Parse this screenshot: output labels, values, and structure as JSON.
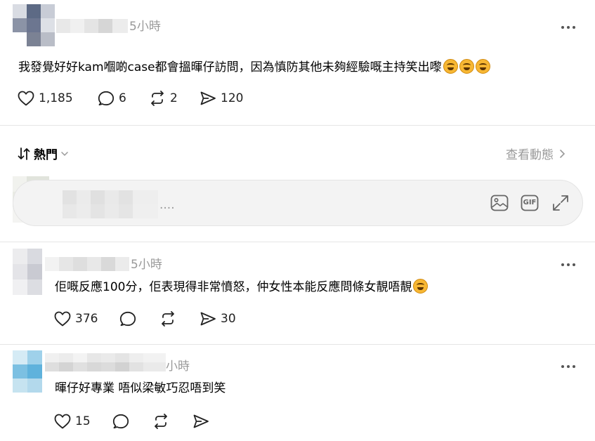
{
  "post": {
    "time": "5小時",
    "text": "我發覺好好kam嗰啲case都會搵暉仔訪問，因為慎防其他未夠經驗嘅主持笑出嚟",
    "emoji_count": 3,
    "likes": "1,185",
    "replies": "6",
    "reposts": "2",
    "shares": "120"
  },
  "filter_bar": {
    "sort_label": "熱門",
    "activity_link": "查看動態"
  },
  "composer": {
    "placeholder": "....",
    "gif_label": "GIF"
  },
  "comments": [
    {
      "time": "5小時",
      "text": "佢嘅反應100分，佢表現得非常憤怒，仲女性本能反應問條女靚唔靚",
      "emoji_count": 1,
      "likes": "376",
      "shares": "30"
    },
    {
      "time": "小時",
      "text": "暉仔好專業 唔似梁敏巧忍唔到笑",
      "emoji_count": 0,
      "likes": "15"
    }
  ],
  "colors": {
    "muted": "#999999",
    "divider": "#e5e5e5",
    "composer_bg": "#f3f3f3",
    "emoji": "#f7b733"
  },
  "icons": [
    "heart-icon",
    "reply-icon",
    "repost-icon",
    "share-icon",
    "sort-icon",
    "chevron-down-icon",
    "chevron-right-icon",
    "image-icon",
    "gif-icon",
    "expand-icon",
    "more-icon"
  ]
}
